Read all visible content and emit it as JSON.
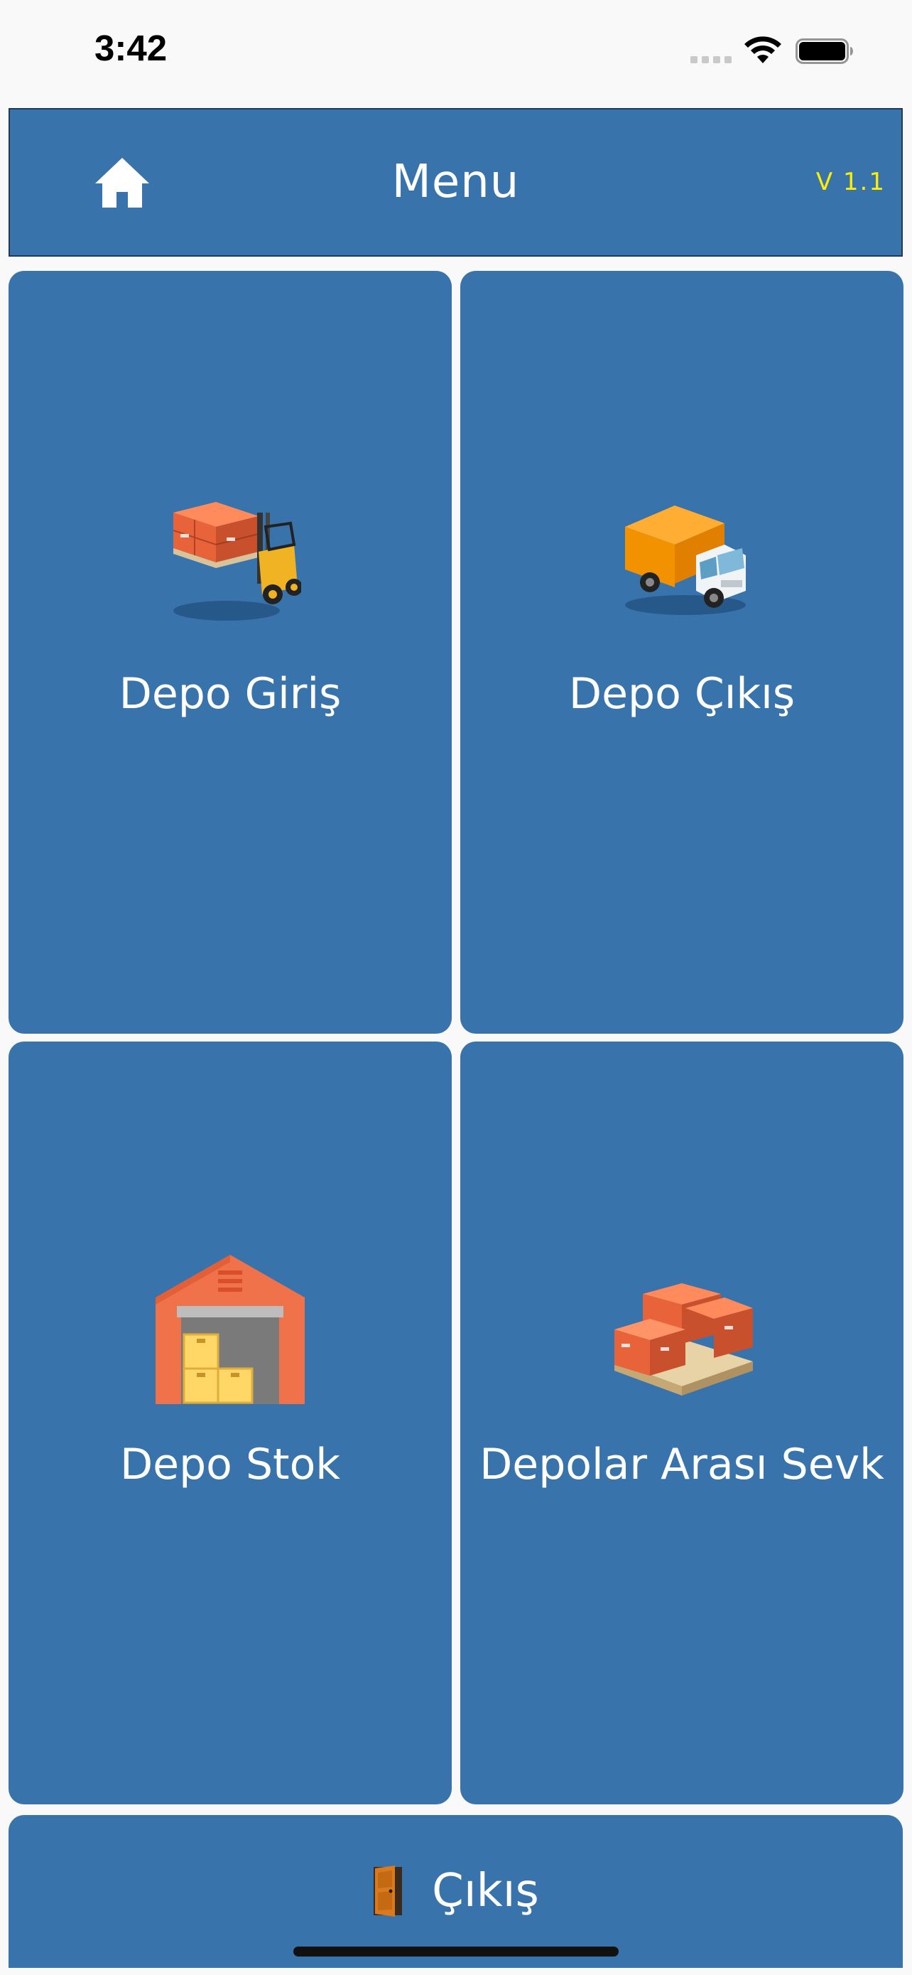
{
  "status_bar": {
    "time": "3:42"
  },
  "header": {
    "title": "Menu",
    "version": "V 1.1",
    "home_icon": "home-icon"
  },
  "tiles": [
    {
      "label": "Depo Giriş",
      "icon": "forklift-icon"
    },
    {
      "label": "Depo Çıkış",
      "icon": "delivery-truck-icon"
    },
    {
      "label": "Depo Stok",
      "icon": "warehouse-icon"
    },
    {
      "label": "Depolar Arası Sevk",
      "icon": "pallet-boxes-icon"
    }
  ],
  "exit": {
    "label": "Çıkış",
    "icon": "door-icon"
  },
  "colors": {
    "primary": "#3873ab",
    "version": "#ffee00",
    "text": "#ffffff"
  }
}
